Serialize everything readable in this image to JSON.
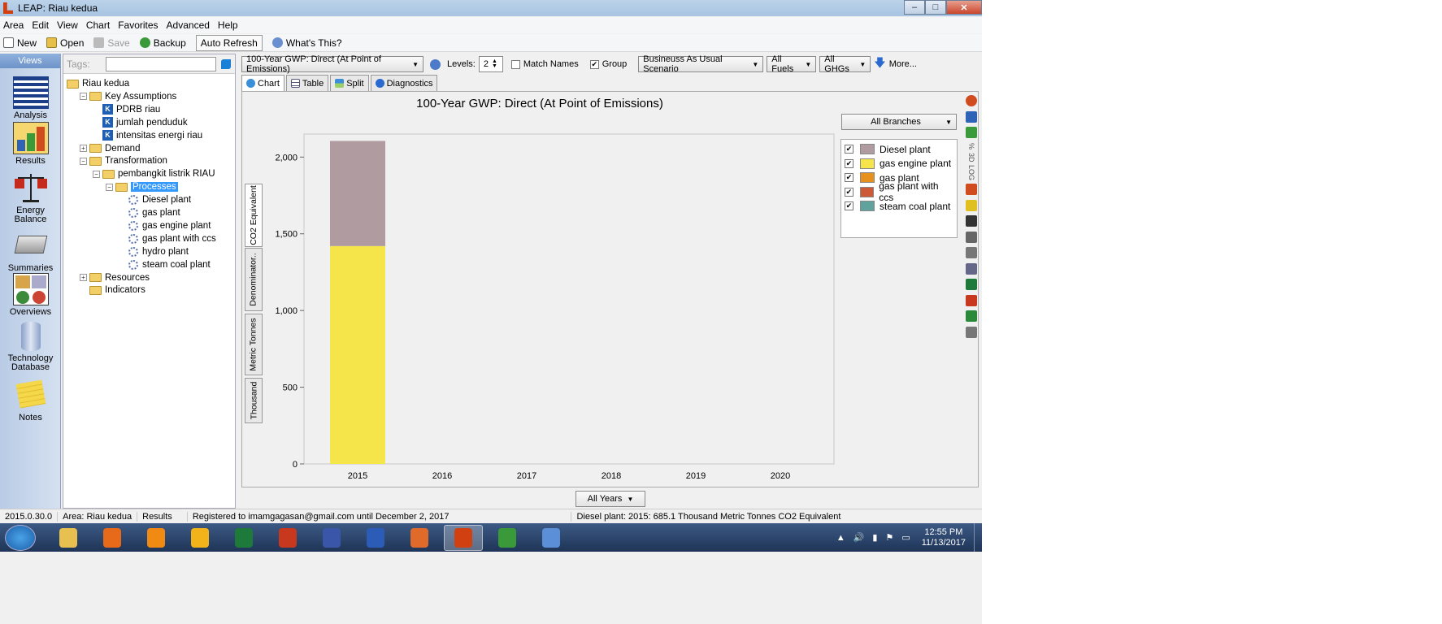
{
  "window": {
    "title": "LEAP: Riau kedua",
    "minimize": "–",
    "maximize": "□",
    "close": "✕"
  },
  "menu": [
    "Area",
    "Edit",
    "View",
    "Chart",
    "Favorites",
    "Advanced",
    "Help"
  ],
  "toolbar": {
    "new": "New",
    "open": "Open",
    "save": "Save",
    "backup": "Backup",
    "auto_refresh": "Auto Refresh",
    "whats_this": "What's This?"
  },
  "views": {
    "header": "Views",
    "items": [
      "Analysis",
      "Results",
      "Energy Balance",
      "Summaries",
      "Overviews",
      "Technology Database",
      "Notes"
    ],
    "selected": "Results"
  },
  "tags": {
    "label": "Tags:",
    "value": ""
  },
  "tree": [
    {
      "label": "Riau kedua",
      "icon": "folder-icon",
      "level": 0
    },
    {
      "label": "Key Assumptions",
      "icon": "folder-icon",
      "level": 1,
      "toggle": "−"
    },
    {
      "label": "PDRB riau",
      "icon": "key-assumption-icon",
      "level": 2
    },
    {
      "label": "jumlah penduduk",
      "icon": "key-assumption-icon",
      "level": 2
    },
    {
      "label": "intensitas energi riau",
      "icon": "key-assumption-icon",
      "level": 2
    },
    {
      "label": "Demand",
      "icon": "folder-icon",
      "level": 1,
      "toggle": "+"
    },
    {
      "label": "Transformation",
      "icon": "folder-icon",
      "level": 1,
      "toggle": "−"
    },
    {
      "label": "pembangkit listrik RIAU",
      "icon": "folder-icon",
      "level": 2,
      "toggle": "−"
    },
    {
      "label": "Processes",
      "icon": "folder-icon",
      "level": 3,
      "toggle": "−",
      "selected": true
    },
    {
      "label": "Diesel plant",
      "icon": "process-gear-icon",
      "level": 4
    },
    {
      "label": "gas plant",
      "icon": "process-gear-icon",
      "level": 4
    },
    {
      "label": "gas engine plant",
      "icon": "process-gear-icon",
      "level": 4
    },
    {
      "label": "gas plant with ccs",
      "icon": "process-gear-icon",
      "level": 4
    },
    {
      "label": "hydro plant",
      "icon": "process-gear-icon",
      "level": 4
    },
    {
      "label": "steam coal plant",
      "icon": "process-gear-icon",
      "level": 4
    },
    {
      "label": "Resources",
      "icon": "folder-icon",
      "level": 1,
      "toggle": "+"
    },
    {
      "label": "Indicators",
      "icon": "folder-icon",
      "level": 1
    }
  ],
  "options": {
    "indicator": "100-Year GWP: Direct (At Point of Emissions)",
    "levels_label": "Levels:",
    "levels_value": "2",
    "match_names": "Match Names",
    "match_names_checked": false,
    "group": "Group",
    "group_checked": true,
    "scenario": "Busineuss As Usual Scenario",
    "fuels": "All Fuels",
    "ghgs": "All GHGs",
    "more": "More..."
  },
  "tabs": [
    "Chart",
    "Table",
    "Split",
    "Diagnostics"
  ],
  "active_tab": "Chart",
  "branches_dropdown": "All Branches",
  "unit_tabs": [
    "CO2 Equivalent",
    "Denominator..",
    "Metric Tonnes",
    "Thousand"
  ],
  "years_dropdown": "All Years",
  "legend": [
    {
      "name": "Diesel  plant",
      "color": "#b09ca0",
      "checked": true
    },
    {
      "name": "gas engine plant",
      "color": "#f6e54a",
      "checked": true
    },
    {
      "name": "gas plant",
      "color": "#e6901e",
      "checked": true
    },
    {
      "name": "gas plant with ccs",
      "color": "#cc5a36",
      "checked": true
    },
    {
      "name": "steam coal plant",
      "color": "#5fa39c",
      "checked": true
    }
  ],
  "side_icons": [
    "pie-chart-icon",
    "bar-chart-icon",
    "color-palette-icon",
    "sum-icon",
    "3d-icon",
    "log-icon",
    "grid-icon",
    "number-format-icon",
    "font-icon",
    "picture-icon",
    "print-icon",
    "copy-icon",
    "excel-icon",
    "powerpoint-icon",
    "save-chart-icon",
    "settings-icon"
  ],
  "side_labels": [
    "%",
    "3D",
    "LOG"
  ],
  "chart_data": {
    "type": "bar",
    "stacked": true,
    "title": "100-Year GWP: Direct (At Point of Emissions)",
    "categories": [
      "2015",
      "2016",
      "2017",
      "2018",
      "2019",
      "2020"
    ],
    "series": [
      {
        "name": "gas engine plant",
        "color": "#f6e54a",
        "values": [
          1420,
          0,
          0,
          0,
          0,
          0
        ]
      },
      {
        "name": "Diesel  plant",
        "color": "#b09ca0",
        "values": [
          685.1,
          0,
          0,
          0,
          0,
          0
        ]
      }
    ],
    "ylim": [
      0,
      2150
    ],
    "yticks": [
      0,
      500,
      1000,
      1500,
      2000
    ],
    "ytick_labels": [
      "0",
      "500",
      "1,000",
      "1,500",
      "2,000"
    ],
    "grid": false
  },
  "status": {
    "version": "2015.0.30.0",
    "area": "Area: Riau kedua",
    "view": "Results",
    "registration": "Registered to imamgagasan@gmail.com until December 2, 2017",
    "hover": "Diesel plant: 2015: 685.1 Thousand Metric Tonnes CO2 Equivalent"
  },
  "taskbar": {
    "apps": [
      "file-explorer-icon",
      "firefox-icon",
      "vlc-icon",
      "media-player-icon",
      "excel-icon",
      "powerpoint-icon",
      "visio-icon",
      "word-icon",
      "video-icon",
      "leap-icon",
      "chrome-icon",
      "paint-icon"
    ],
    "active_app": "leap-icon",
    "time": "12:55 PM",
    "date": "11/13/2017"
  }
}
